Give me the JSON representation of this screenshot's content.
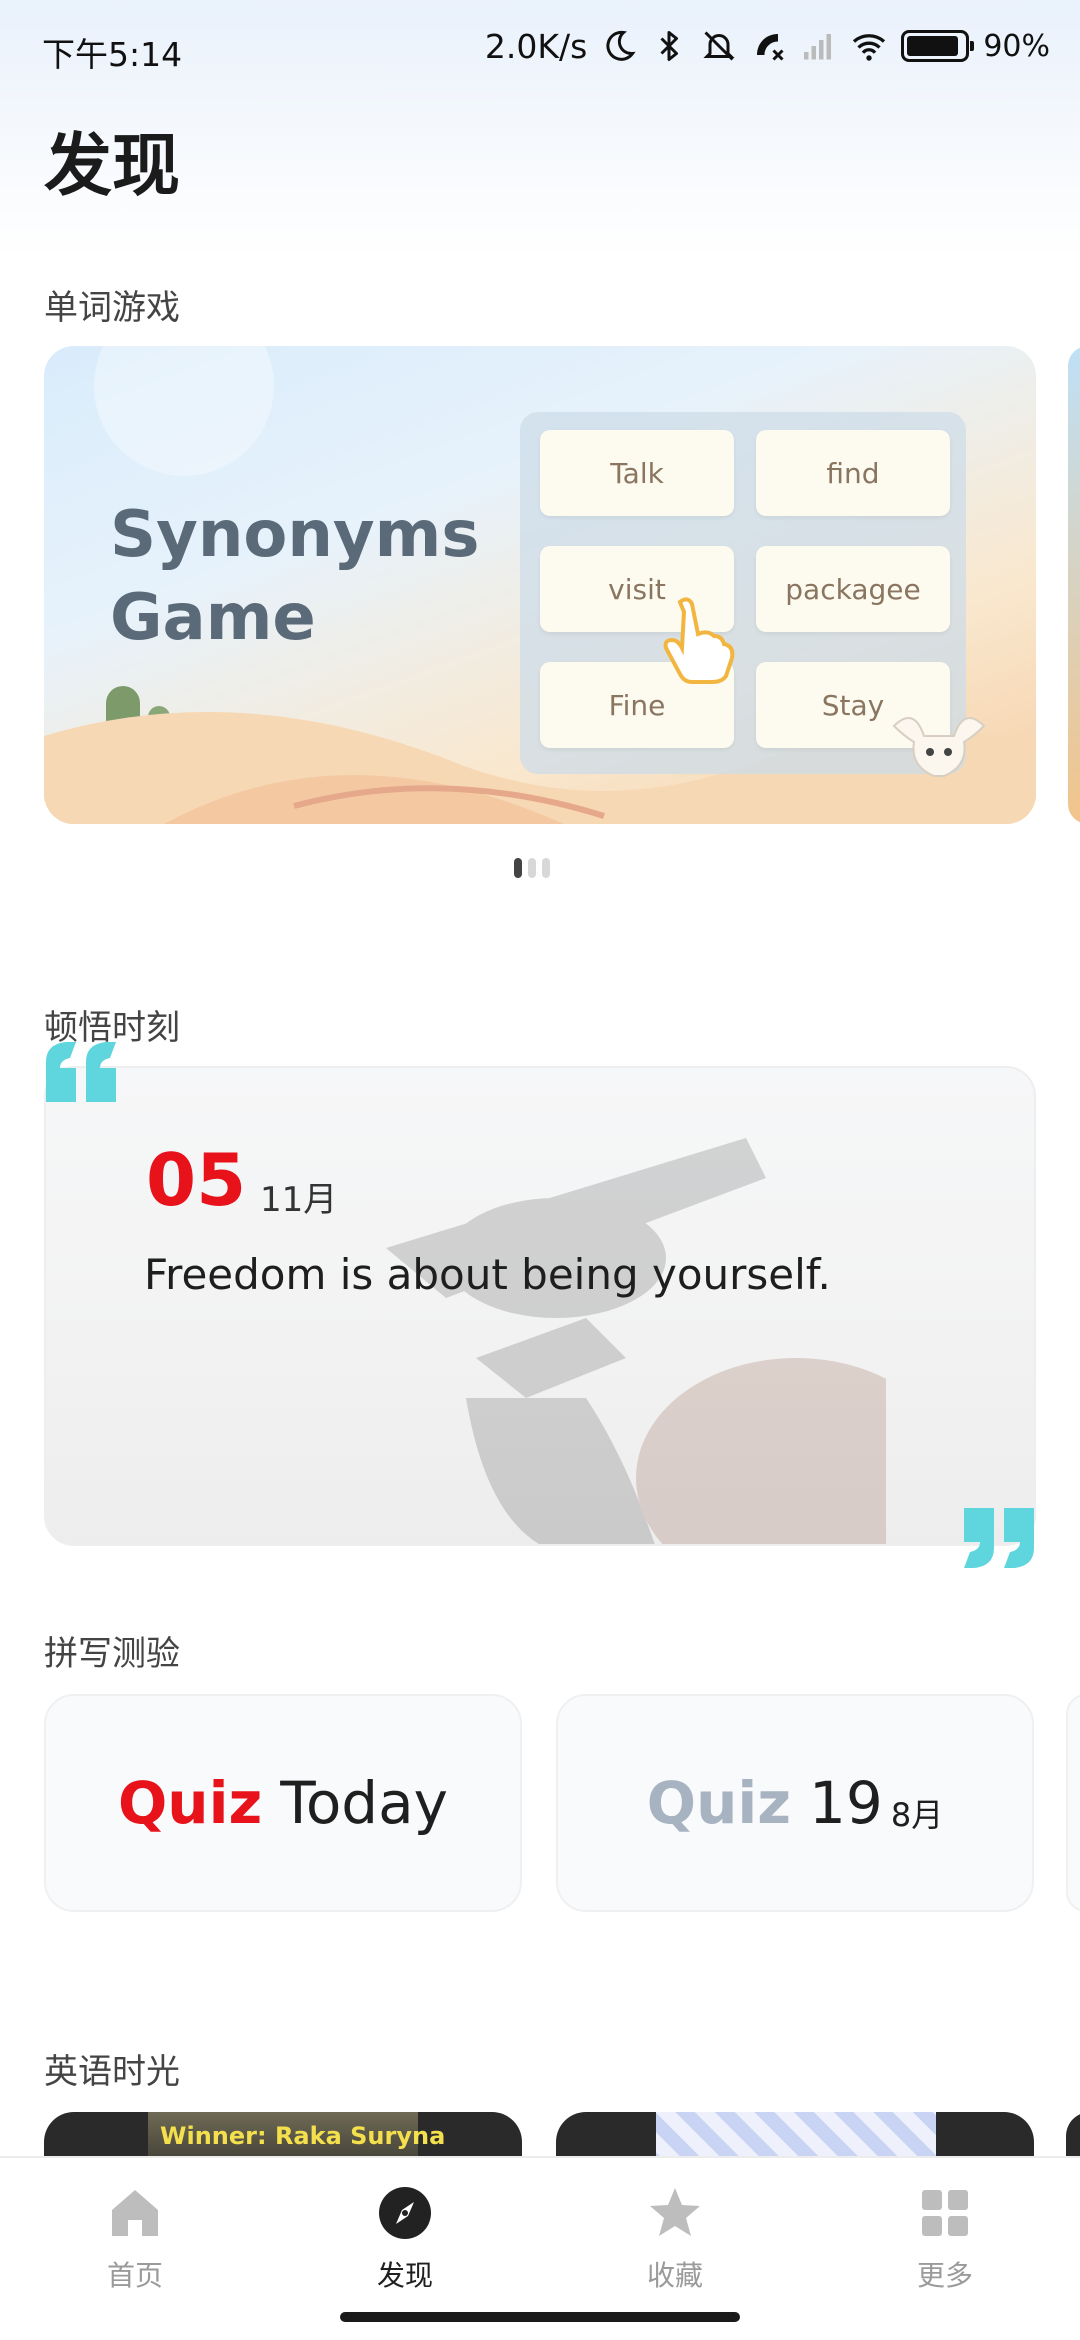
{
  "status_bar": {
    "time": "下午5:14",
    "net_speed": "2.0K/s",
    "battery_percent": "90%",
    "battery_level": 0.9,
    "icons": [
      "moon-icon",
      "bluetooth-icon",
      "mute-bell-icon",
      "call-off-icon",
      "cellular-signal-icon",
      "wifi-icon",
      "battery-icon"
    ]
  },
  "page": {
    "title": "发现"
  },
  "word_games": {
    "section_title": "单词游戏",
    "banner": {
      "title_line1": "Synonyms",
      "title_line2": "Game",
      "tiles": [
        "Talk",
        "find",
        "visit",
        "packagee",
        "Fine",
        "Stay"
      ]
    },
    "pager": {
      "count": 3,
      "active_index": 0
    }
  },
  "insight": {
    "section_title": "顿悟时刻",
    "day": "05",
    "month": "11月",
    "quote": "Freedom is about being yourself.",
    "accent_color": "#e8121b",
    "quote_mark_color": "#5fd6de"
  },
  "spelling_quiz": {
    "section_title": "拼写测验",
    "cards": [
      {
        "word": "Quiz",
        "label": "Today",
        "sub": ""
      },
      {
        "word": "Quiz",
        "label": "19",
        "sub": "8月"
      }
    ]
  },
  "english_time": {
    "section_title": "英语时光",
    "video1_caption": "Winner: Raka Suryna"
  },
  "bottom_nav": {
    "items": [
      {
        "label": "首页",
        "icon": "home-icon",
        "active": false
      },
      {
        "label": "发现",
        "icon": "compass-icon",
        "active": true
      },
      {
        "label": "收藏",
        "icon": "star-icon",
        "active": false
      },
      {
        "label": "更多",
        "icon": "grid-icon",
        "active": false
      }
    ]
  }
}
